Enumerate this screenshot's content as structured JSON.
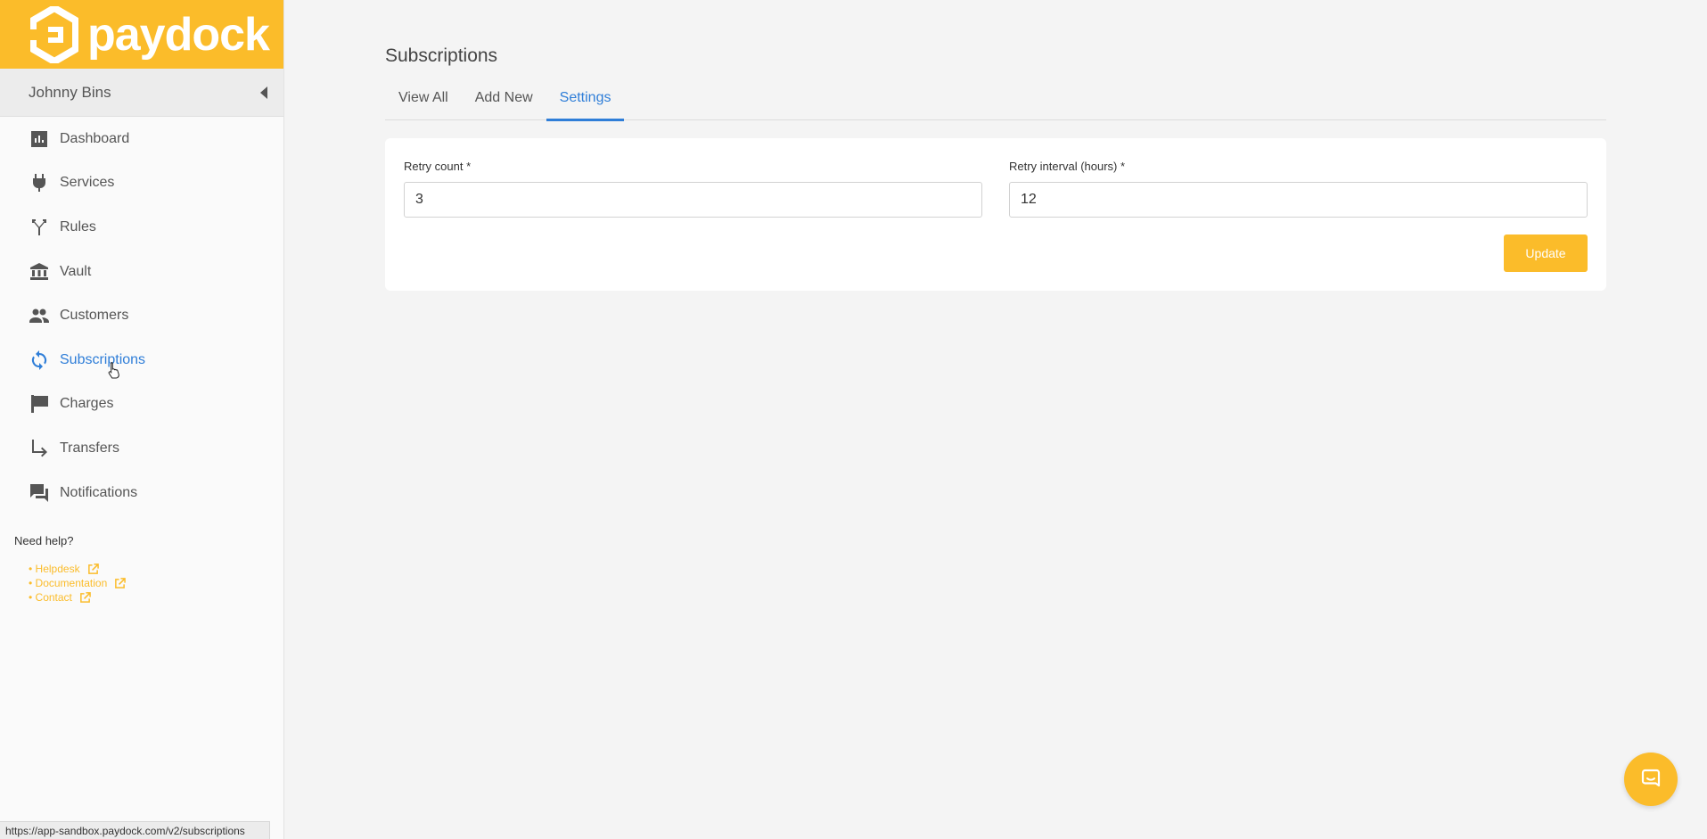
{
  "brand": {
    "name": "paydock",
    "accent": "#fbbc2a",
    "active_color": "#2f7ed8"
  },
  "user": {
    "name": "Johnny Bins"
  },
  "sidebar": {
    "items": [
      {
        "label": "Dashboard",
        "icon": "bar-chart-icon"
      },
      {
        "label": "Services",
        "icon": "plug-icon"
      },
      {
        "label": "Rules",
        "icon": "fork-icon"
      },
      {
        "label": "Vault",
        "icon": "bank-icon"
      },
      {
        "label": "Customers",
        "icon": "people-icon"
      },
      {
        "label": "Subscriptions",
        "icon": "refresh-icon",
        "active": true
      },
      {
        "label": "Charges",
        "icon": "flag-icon"
      },
      {
        "label": "Transfers",
        "icon": "arrow-turn-icon"
      },
      {
        "label": "Notifications",
        "icon": "chat-bubbles-icon"
      }
    ],
    "help_title": "Need help?",
    "help_links": [
      "• Helpdesk",
      "• Documentation",
      "• Contact"
    ]
  },
  "page": {
    "title": "Subscriptions",
    "tabs": [
      "View All",
      "Add New",
      "Settings"
    ],
    "active_tab": "Settings"
  },
  "form": {
    "retry_count_label": "Retry count *",
    "retry_count_value": "3",
    "retry_interval_label": "Retry interval (hours) *",
    "retry_interval_value": "12",
    "update_label": "Update"
  },
  "status_url": "https://app-sandbox.paydock.com/v2/subscriptions"
}
